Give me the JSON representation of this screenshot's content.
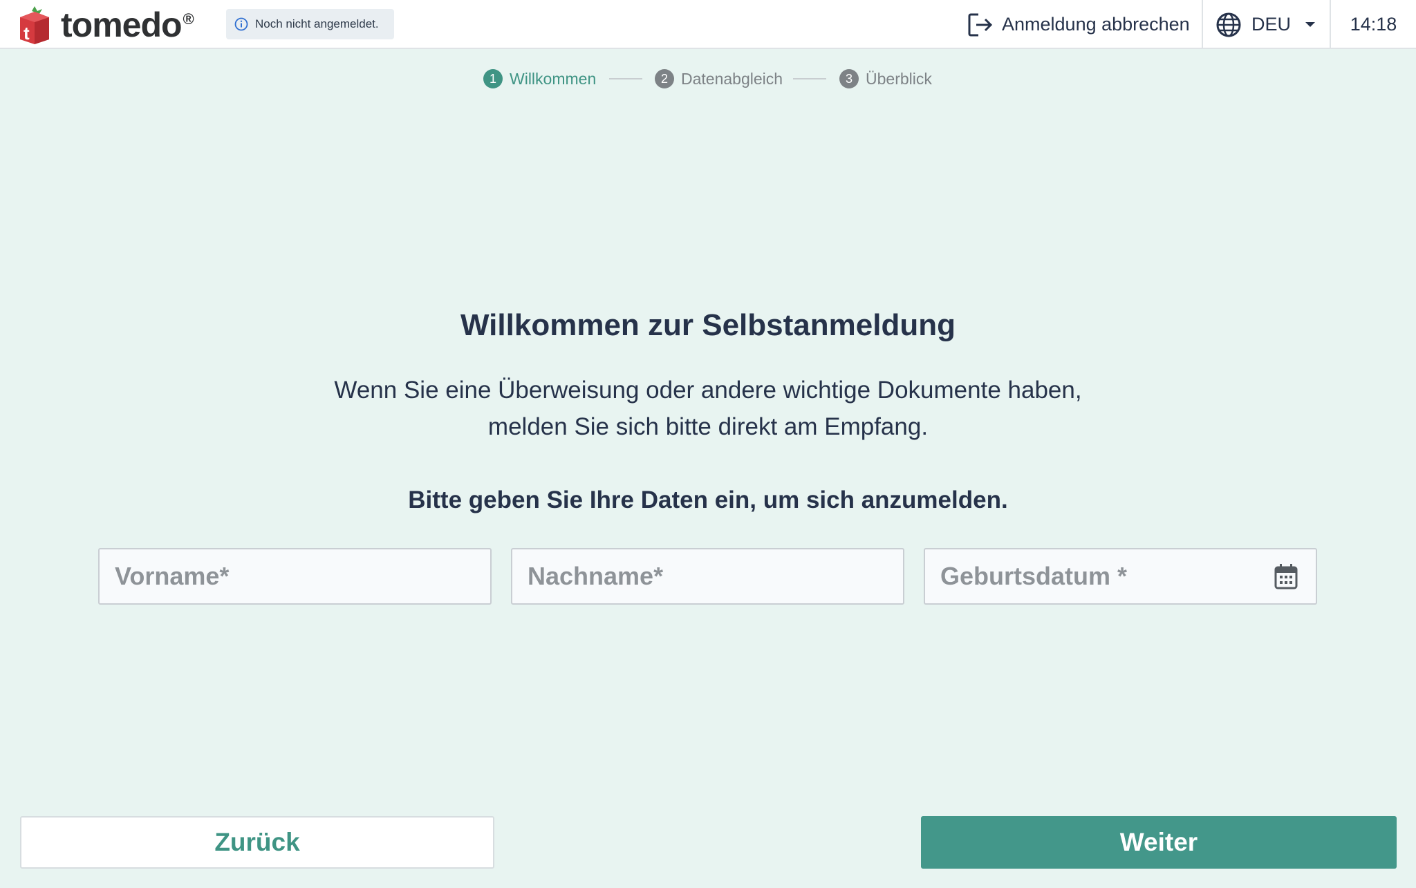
{
  "header": {
    "logo_text": "tomedo",
    "logo_reg": "®",
    "logo_letter": "t",
    "status": "Noch nicht angemeldet.",
    "cancel_label": "Anmeldung abbrechen",
    "language": "DEU",
    "time": "14:18"
  },
  "stepper": {
    "steps": [
      {
        "num": "1",
        "label": "Willkommen",
        "state": "active"
      },
      {
        "num": "2",
        "label": "Datenabgleich",
        "state": "pending"
      },
      {
        "num": "3",
        "label": "Überblick",
        "state": "pending"
      }
    ]
  },
  "main": {
    "title": "Willkommen zur Selbstanmeldung",
    "intro_line1": "Wenn Sie eine Überweisung oder andere wichtige Dokumente haben,",
    "intro_line2": "melden Sie sich bitte direkt am Empfang.",
    "prompt": "Bitte geben Sie Ihre Daten ein, um sich anzumelden.",
    "fields": {
      "firstname": {
        "placeholder": "Vorname*",
        "value": ""
      },
      "lastname": {
        "placeholder": "Nachname*",
        "value": ""
      },
      "birthdate": {
        "placeholder": "Geburtsdatum *",
        "value": ""
      }
    }
  },
  "footer": {
    "back_label": "Zurück",
    "next_label": "Weiter"
  },
  "colors": {
    "accent": "#43978a",
    "background": "#e8f4f1",
    "text": "#26324a",
    "logo_red": "#d53a3f"
  },
  "icons": [
    "logo-cube-icon",
    "info-icon",
    "logout-icon",
    "globe-icon",
    "caret-down-icon",
    "calendar-icon"
  ]
}
